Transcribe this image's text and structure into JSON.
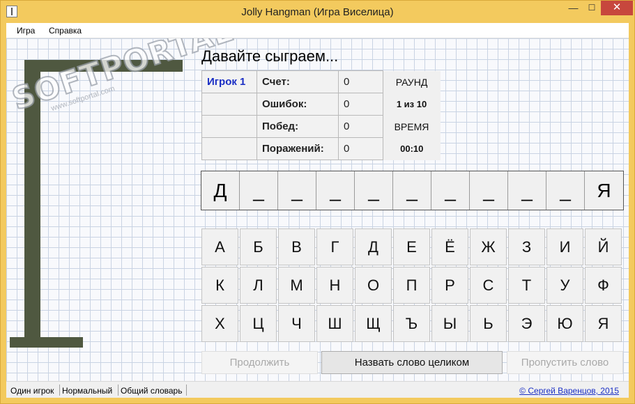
{
  "window": {
    "title": "Jolly Hangman (Игра Виселица)",
    "min_glyph": "—",
    "max_glyph": "☐",
    "close_glyph": "✕"
  },
  "menu": {
    "items": [
      "Игра",
      "Справка"
    ]
  },
  "watermark": {
    "logo": "SOFTPORTAL",
    "url": "www.softportal.com"
  },
  "headline": "Давайте сыграем...",
  "score": {
    "player": "Игрок 1",
    "rows": [
      {
        "label": "Счет:",
        "value": "0"
      },
      {
        "label": "Ошибок:",
        "value": "0"
      },
      {
        "label": "Побед:",
        "value": "0"
      },
      {
        "label": "Поражений:",
        "value": "0"
      }
    ],
    "round_label": "РАУНД",
    "round_value": "1 из 10",
    "time_label": "ВРЕМЯ",
    "time_value": "00:10"
  },
  "word": [
    "Д",
    "_",
    "_",
    "_",
    "_",
    "_",
    "_",
    "_",
    "_",
    "_",
    "Я"
  ],
  "keyboard": [
    "А",
    "Б",
    "В",
    "Г",
    "Д",
    "Е",
    "Ё",
    "Ж",
    "З",
    "И",
    "Й",
    "К",
    "Л",
    "М",
    "Н",
    "О",
    "П",
    "Р",
    "С",
    "Т",
    "У",
    "Ф",
    "Х",
    "Ц",
    "Ч",
    "Ш",
    "Щ",
    "Ъ",
    "Ы",
    "Ь",
    "Э",
    "Ю",
    "Я"
  ],
  "buttons": {
    "continue": "Продолжить",
    "name_word": "Назвать слово целиком",
    "skip": "Пропустить слово"
  },
  "status": {
    "mode": "Один игрок",
    "difficulty": "Нормальный",
    "dictionary": "Общий словарь",
    "copyright": "© Сергей Варенцов, 2015"
  },
  "colors": {
    "titlebar": "#f3ca5e",
    "accent_blue": "#1a2ec4",
    "gallows": "#4f5840",
    "close": "#c7473d"
  }
}
